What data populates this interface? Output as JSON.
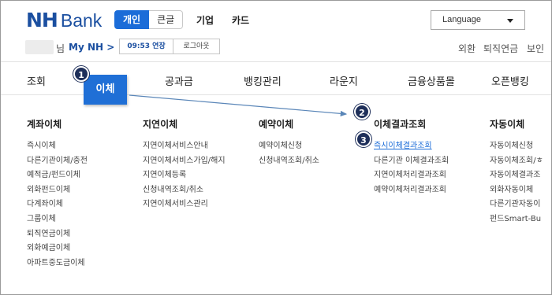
{
  "brand": {
    "nh": "NH",
    "bank": "Bank",
    "color": "#1b4fa0"
  },
  "segment": {
    "personal": "개인",
    "corporate": "큰글"
  },
  "top_links": {
    "business": "기업",
    "card": "카드"
  },
  "language": {
    "label": "Language"
  },
  "user": {
    "suffix": "님",
    "mynh": "My NH >"
  },
  "session": {
    "time": "09:53 연장",
    "logout": "로그아웃"
  },
  "util_links": {
    "forex": "외환",
    "pension": "퇴직연금",
    "insurance": "보인"
  },
  "nav": {
    "items": [
      "조회",
      "이체",
      "공과금",
      "뱅킹관리",
      "라운지",
      "금융상품몰",
      "오픈뱅킹"
    ],
    "active": "이체",
    "active_color": "#1f6fd6"
  },
  "callouts": {
    "c1": "1",
    "c2": "2",
    "c3": "3"
  },
  "menu": {
    "columns": [
      {
        "title": "계좌이체",
        "items": [
          "즉시이체",
          "다른기관이체/충전",
          "예적금/펀드이체",
          "외화펀드이체",
          "다계좌이체",
          "그룹이체",
          "퇴직연금이체",
          "외화예금이체",
          "아파트중도금이체"
        ]
      },
      {
        "title": "지연이체",
        "items": [
          "지연이체서비스안내",
          "지연이체서비스가입/해지",
          "지연이체등록",
          "신청내역조회/취소",
          "지연이체서비스관리"
        ]
      },
      {
        "title": "예약이체",
        "items": [
          "예약이체신청",
          "신청내역조회/취소"
        ]
      },
      {
        "title": "이체결과조회",
        "items": [
          "즉시이체결과조회",
          "다른기관 이체결과조회",
          "지연이체처리결과조회",
          "예약이체처리결과조회"
        ]
      },
      {
        "title": "자동이체",
        "items": [
          "자동이체신청",
          "자동이체조회/ㅎ",
          "자동이체결과조",
          "외화자동이체",
          "다른기관자동이",
          "펀드Smart-Bu"
        ]
      }
    ]
  },
  "highlight_color": "#1b6cd8"
}
